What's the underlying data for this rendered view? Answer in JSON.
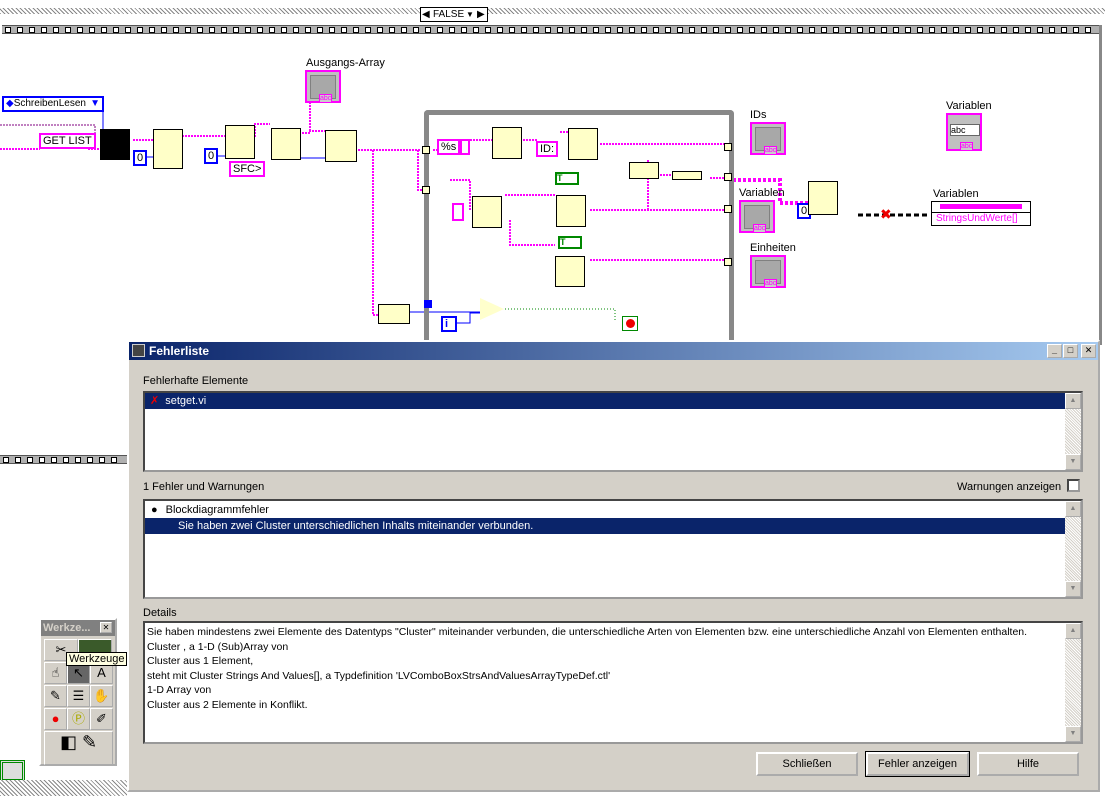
{
  "diagram": {
    "case_selector": "FALSE",
    "enum_constant": "SchreibenLesen",
    "get_list_constant": "GET LIST",
    "sfc_constant": "SFC>",
    "format_constant": "%s",
    "id_constant": "ID:",
    "zero_constants": [
      "0",
      "0",
      "0"
    ],
    "loop_index": "i",
    "labels": {
      "ausgangs_array": "Ausgangs-Array",
      "ids": "IDs",
      "variablen_1": "Variablen",
      "variablen_2": "Variablen",
      "variablen_3": "Variablen",
      "einheiten": "Einheiten"
    },
    "strings_und_werte": "StringsUndWerte[]",
    "combo_text": "abc",
    "indicator_num": "123",
    "indicator_type": "abc"
  },
  "tools_palette": {
    "title": "Werkze...",
    "tooltip": "Werkzeuge"
  },
  "dialog": {
    "title": "Fehlerliste",
    "items_label": "Fehlerhafte Elemente",
    "items": [
      {
        "name": "setget.vi",
        "icon": "error-x-icon"
      }
    ],
    "errors_label": "1 Fehler und Warnungen",
    "show_warnings_label": "Warnungen anzeigen",
    "show_warnings_checked": false,
    "errors": [
      {
        "text": "Blockdiagrammfehler",
        "type": "category"
      },
      {
        "text": "Sie haben zwei Cluster unterschiedlichen Inhalts miteinander verbunden.",
        "type": "message"
      }
    ],
    "details_label": "Details",
    "details_lines": [
      "Sie haben mindestens zwei Elemente des Datentyps \"Cluster\" miteinander verbunden, die unterschiedliche Arten von Elementen bzw. eine unterschiedliche Anzahl von Elementen enthalten.",
      "Cluster , a 1-D (Sub)Array von",
      "Cluster aus 1 Element,",
      "steht mit Cluster Strings And Values[], a Typdefinition 'LVComboBoxStrsAndValuesArrayTypeDef.ctl'",
      "1-D Array von",
      "Cluster aus 2 Elemente in Konflikt."
    ],
    "buttons": {
      "close": "Schließen",
      "show_error": "Fehler anzeigen",
      "help": "Hilfe"
    }
  }
}
